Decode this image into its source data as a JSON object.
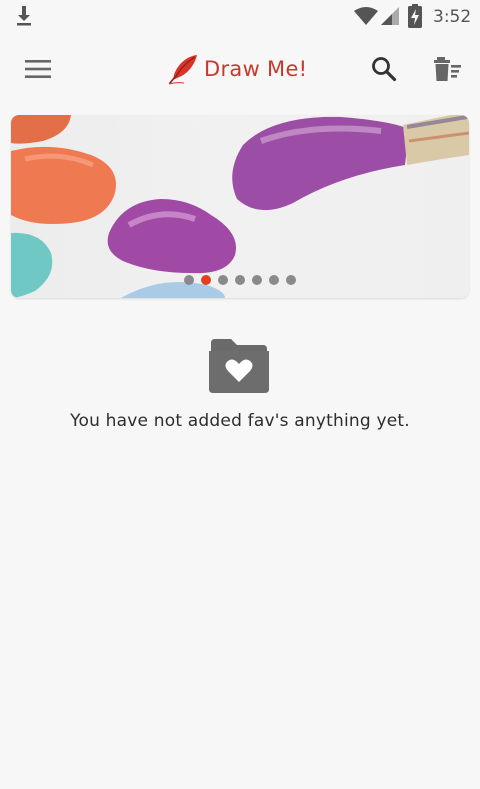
{
  "status_bar": {
    "time": "3:52",
    "icons": [
      "download-icon",
      "wifi-icon",
      "signal-icon",
      "battery-charging-icon"
    ]
  },
  "app_bar": {
    "title": "Draw Me!",
    "icons": [
      "menu-icon",
      "feather-icon",
      "search-icon",
      "clear-list-icon"
    ],
    "colors": {
      "title": "#c7392c"
    }
  },
  "banner": {
    "page_count": 7,
    "active_page": 2,
    "colors": {
      "active_dot": "#e0401f",
      "inactive_dot": "#8a8a8a"
    }
  },
  "empty_state": {
    "icon": "folder-heart-icon",
    "message": "You have not added fav's anything yet."
  }
}
